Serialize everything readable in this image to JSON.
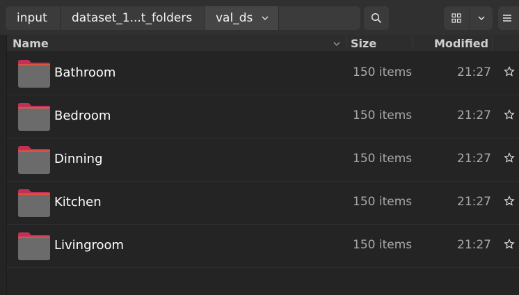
{
  "header": {
    "breadcrumbs": [
      "input",
      "dataset_1...t_folders",
      "val_ds"
    ]
  },
  "columns": {
    "name": "Name",
    "size": "Size",
    "modified": "Modified"
  },
  "colors": {
    "folder_tab": "#c2305a",
    "folder_body": "#6b6b6b",
    "background": "#242424"
  },
  "rows": [
    {
      "name": "Bathroom",
      "size": "150 items",
      "modified": "21:27"
    },
    {
      "name": "Bedroom",
      "size": "150 items",
      "modified": "21:27"
    },
    {
      "name": "Dinning",
      "size": "150 items",
      "modified": "21:27"
    },
    {
      "name": "Kitchen",
      "size": "150 items",
      "modified": "21:27"
    },
    {
      "name": "Livingroom",
      "size": "150 items",
      "modified": "21:27"
    }
  ]
}
